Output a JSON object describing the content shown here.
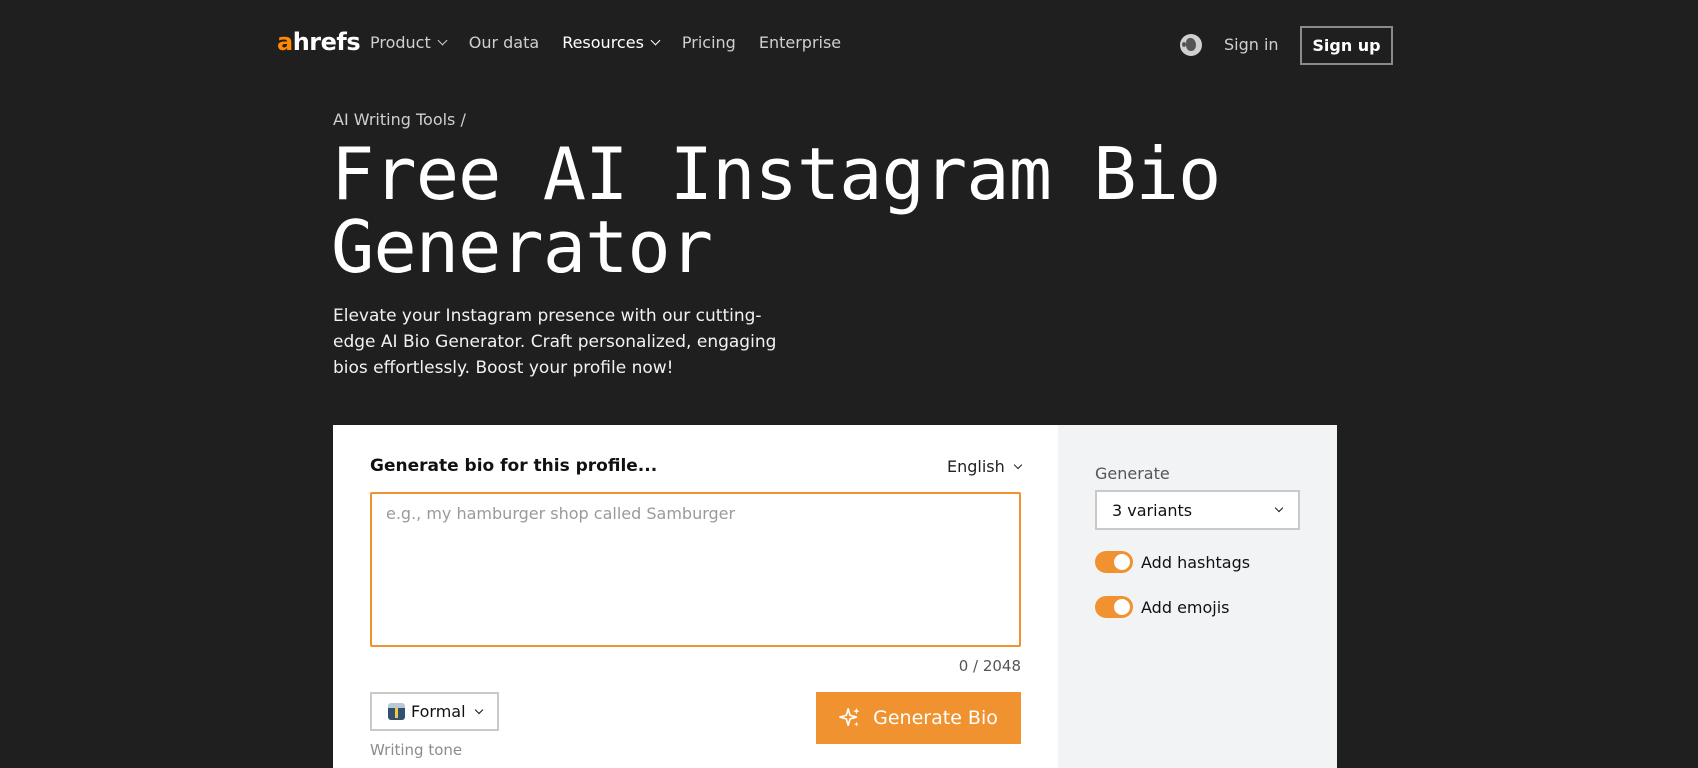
{
  "nav": {
    "logo_accent": "a",
    "logo_rest": "hrefs",
    "links": [
      {
        "label": "Product",
        "has_menu": true
      },
      {
        "label": "Our data",
        "has_menu": false
      },
      {
        "label": "Resources",
        "has_menu": true
      },
      {
        "label": "Pricing",
        "has_menu": false
      },
      {
        "label": "Enterprise",
        "has_menu": false
      }
    ],
    "sign_in": "Sign in",
    "sign_up": "Sign up"
  },
  "hero": {
    "breadcrumb": "AI Writing Tools /",
    "title_line1": "Free AI Instagram Bio",
    "title_line2": "Generator",
    "subtitle": "Elevate your Instagram presence with our cutting-edge AI Bio Generator. Craft personalized, engaging bios effortlessly. Boost your profile now!"
  },
  "tool": {
    "heading": "Generate bio for this profile...",
    "language": "English",
    "prompt_value": "",
    "prompt_placeholder": "e.g., my hamburger shop called Samburger",
    "char_counter": "0 / 2048",
    "tone_value": "Formal",
    "tone_label": "Writing tone",
    "generate_button": "Generate Bio"
  },
  "options": {
    "generate_label": "Generate",
    "variants_value": "3 variants",
    "hashtags_label": "Add hashtags",
    "hashtags_on": true,
    "emojis_label": "Add emojis",
    "emojis_on": true
  },
  "colors": {
    "accent": "#f0922f",
    "brand_orange": "#ff8800",
    "background": "#1f1f1f",
    "panel": "#f2f3f5"
  }
}
